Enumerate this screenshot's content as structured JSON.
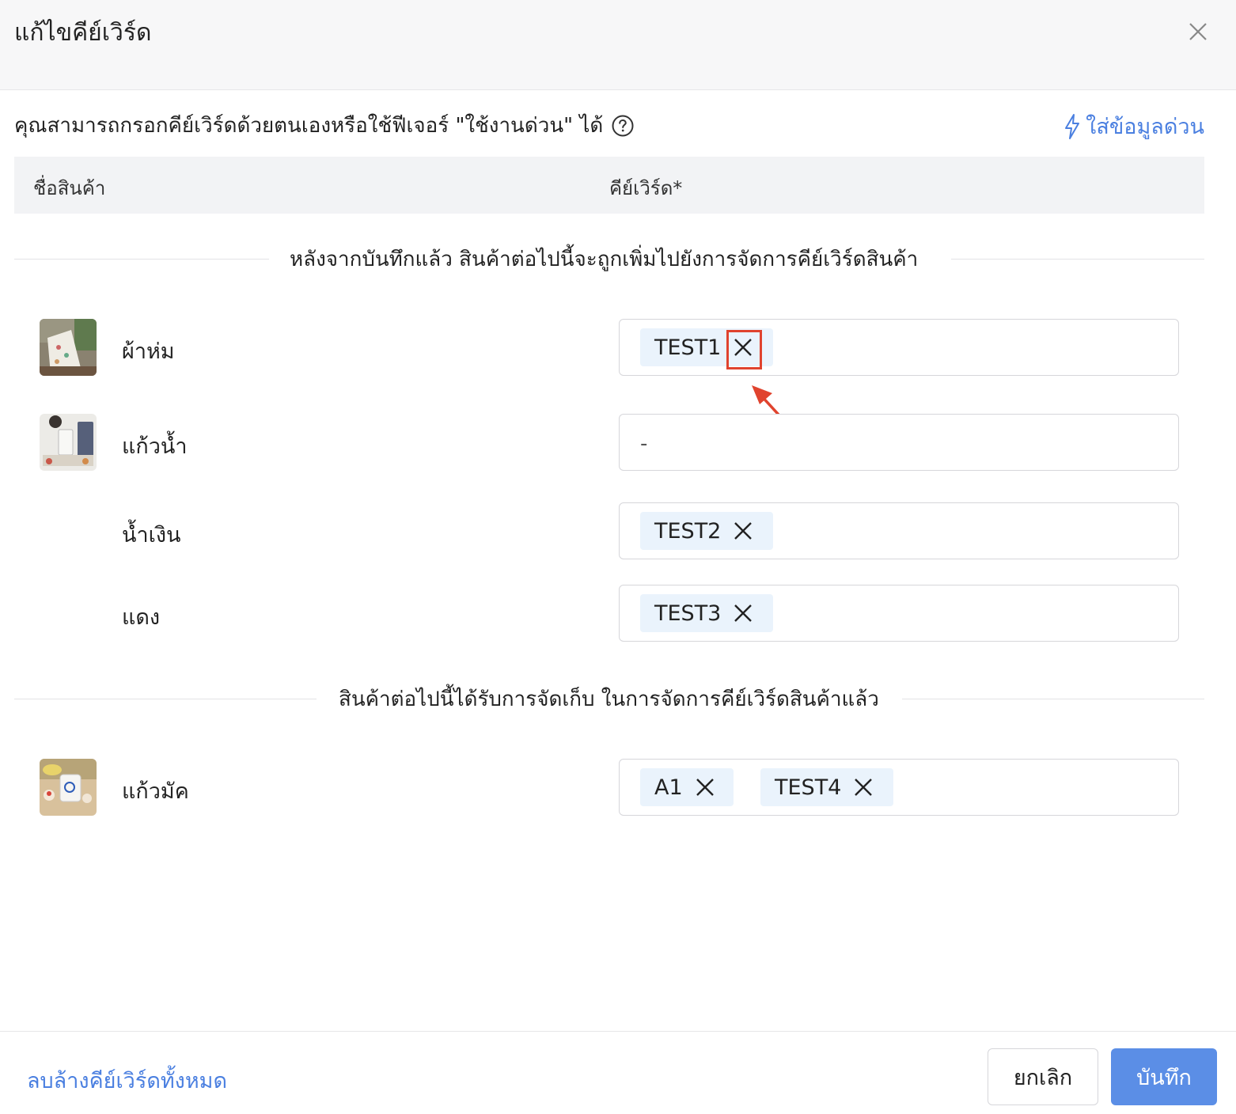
{
  "dialog": {
    "title": "แก้ไขคีย์เวิร์ด",
    "intro_text": "คุณสามารถกรอกคีย์เวิร์ดด้วยตนเองหรือใช้ฟีเจอร์ \"ใช้งานด่วน\" ได้",
    "quick_fill_label": "ใส่ข้อมูลด่วน"
  },
  "table": {
    "col_product": "ชื่อสินค้า",
    "col_keyword": "คีย์เวิร์ด*"
  },
  "sections": {
    "new_label": "หลังจากบันทึกแล้ว สินค้าต่อไปนี้จะถูกเพิ่มไปยังการจัดการคีย์เวิร์ดสินค้า",
    "existing_label": "สินค้าต่อไปนี้ได้รับการจัดเก็บ ในการจัดการคีย์เวิร์ดสินค้าแล้ว"
  },
  "products": [
    {
      "name": "ผ้าห่ม",
      "keywords": [
        "TEST1"
      ]
    },
    {
      "name": "แก้วน้ำ",
      "empty_value": "-"
    },
    {
      "name": "น้ำเงิน",
      "keywords": [
        "TEST2"
      ]
    },
    {
      "name": "แดง",
      "keywords": [
        "TEST3"
      ]
    }
  ],
  "existing_products": [
    {
      "name": "แก้วมัค",
      "keywords": [
        "A1",
        "TEST4"
      ]
    }
  ],
  "footer": {
    "clear_all": "ลบล้างคีย์เวิร์ดทั้งหมด",
    "cancel": "ยกเลิก",
    "save": "บันทึก"
  },
  "colors": {
    "accent": "#4a7fe0",
    "primary_button": "#5b8ee6",
    "tag_bg": "#eaf3fc",
    "annotation": "#e0432e"
  }
}
